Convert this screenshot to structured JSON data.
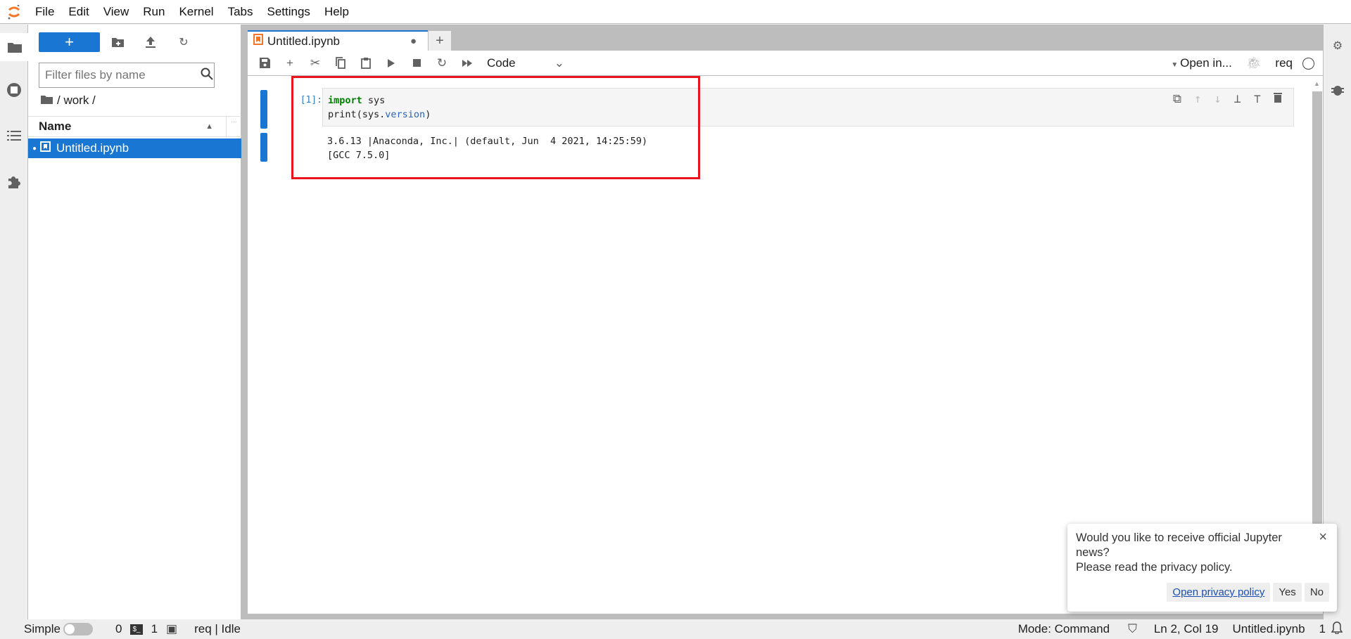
{
  "menubar": {
    "items": [
      "File",
      "Edit",
      "View",
      "Run",
      "Kernel",
      "Tabs",
      "Settings",
      "Help"
    ]
  },
  "filebrowser": {
    "new_label": "+",
    "filter_placeholder": "Filter files by name",
    "breadcrumb": "/ work /",
    "column_name": "Name",
    "files": [
      {
        "name": "Untitled.ipynb",
        "running": true
      }
    ]
  },
  "tab": {
    "title": "Untitled.ipynb"
  },
  "toolbar": {
    "cell_type": "Code",
    "open_in": "Open in...",
    "kernel": "req"
  },
  "cell": {
    "prompt": "[1]:",
    "code_line1_kw": "import",
    "code_line1_rest": " sys",
    "code_line2_a": "print(sys.",
    "code_line2_attr": "version",
    "code_line2_b": ")",
    "output": "3.6.13 |Anaconda, Inc.| (default, Jun  4 2021, 14:25:59)\n[GCC 7.5.0]"
  },
  "notification": {
    "message_line1": "Would you like to receive official Jupyter news?",
    "message_line2": "Please read the privacy policy.",
    "link": "Open privacy policy",
    "yes": "Yes",
    "no": "No"
  },
  "statusbar": {
    "simple": "Simple",
    "terminals": "0",
    "kernels": "1",
    "kernel_status": "req | Idle",
    "mode": "Mode: Command",
    "cursor": "Ln 2, Col 19",
    "file": "Untitled.ipynb",
    "notifications": "1"
  },
  "colors": {
    "accent": "#1976d2",
    "highlight_box": "#e8141e",
    "logo": "#f37726"
  }
}
